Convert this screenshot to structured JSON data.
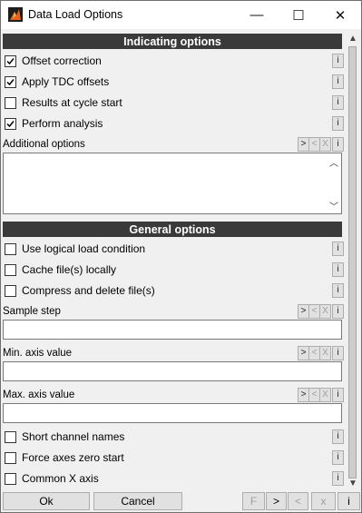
{
  "window": {
    "title": "Data Load Options",
    "minimize_glyph": "—",
    "maximize_glyph": "☐",
    "close_glyph": "✕"
  },
  "sections": {
    "indicating": {
      "title": "Indicating options"
    },
    "general": {
      "title": "General options"
    }
  },
  "indicating_options": [
    {
      "label": "Offset correction",
      "checked": true
    },
    {
      "label": "Apply TDC offsets",
      "checked": true
    },
    {
      "label": "Results at cycle start",
      "checked": false
    },
    {
      "label": "Perform analysis",
      "checked": true
    }
  ],
  "additional_options": {
    "label": "Additional options",
    "value": ""
  },
  "general_options": [
    {
      "label": "Use logical load condition",
      "checked": false
    },
    {
      "label": "Cache file(s) locally",
      "checked": false
    },
    {
      "label": "Compress and delete file(s)",
      "checked": false
    }
  ],
  "fields": {
    "sample_step": {
      "label": "Sample step",
      "value": ""
    },
    "min_axis": {
      "label": "Min. axis value",
      "value": ""
    },
    "max_axis": {
      "label": "Max. axis value",
      "value": ""
    }
  },
  "more_options": [
    {
      "label": "Short channel names",
      "checked": false
    },
    {
      "label": "Force axes zero start",
      "checked": false
    },
    {
      "label": "Common X axis",
      "checked": false
    }
  ],
  "small_buttons": {
    "info": "i",
    "forward": ">",
    "back": "<",
    "clear": "X"
  },
  "scroll_glyphs": {
    "up": "▲",
    "down": "▼",
    "ta_up": "︿",
    "ta_down": "﹀"
  },
  "footer": {
    "ok": "Ok",
    "cancel": "Cancel",
    "f": "F",
    "next": ">",
    "prev": "<",
    "x": "x",
    "info": "i"
  },
  "colors": {
    "section_header_bg": "#3a3a3a",
    "app_icon": "#e8641b"
  }
}
